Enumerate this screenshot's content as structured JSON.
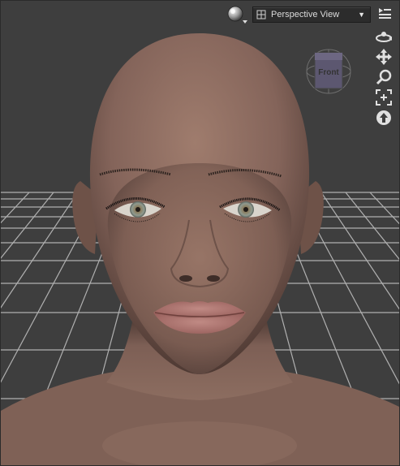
{
  "viewport": {
    "view_selector": {
      "label": "Perspective View"
    },
    "cube_face_label": "Front",
    "icons": {
      "shading": "sphere-shading-icon",
      "camera": "camera-icon",
      "menu": "viewport-menu-icon",
      "orbit": "orbit-icon",
      "pan": "pan-icon",
      "zoom": "zoom-icon",
      "frame": "frame-icon",
      "reset": "reset-view-icon"
    },
    "colors": {
      "background": "#3e3e3e",
      "grid": "#bdbdbd",
      "skin": "#8a6a5c",
      "lips": "#b07874",
      "ui_icon": "#e0e0e0"
    }
  }
}
